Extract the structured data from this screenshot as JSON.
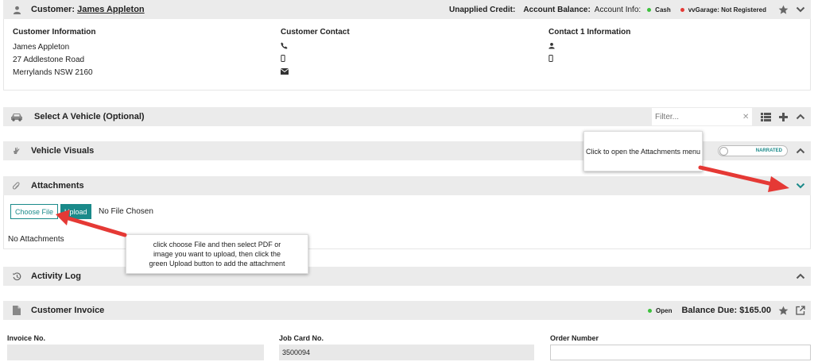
{
  "customer_header": {
    "label": "Customer:",
    "name": "James Appleton",
    "unapplied_credit": "Unapplied Credit:",
    "account_balance": "Account Balance:",
    "account_info": "Account Info:",
    "status_cash": "Cash",
    "status_vvgarage": "vvGarage: Not Registered"
  },
  "customer_body": {
    "info_title": "Customer Information",
    "info_lines": [
      "James Appleton",
      "27 Addlestone Road",
      "Merrylands NSW 2160"
    ],
    "contact_title": "Customer Contact",
    "contact1_title": "Contact 1 Information"
  },
  "vehicle_section": {
    "title": "Select A Vehicle (Optional)",
    "filter_placeholder": "Filter..."
  },
  "visuals_section": {
    "title": "Vehicle Visuals",
    "toggle_label": "NARRATED"
  },
  "attachments_section": {
    "title": "Attachments",
    "choose_label": "Choose File",
    "upload_label": "Upload",
    "file_status": "No File Chosen",
    "empty_text": "No Attachments"
  },
  "activity_section": {
    "title": "Activity Log"
  },
  "invoice_section": {
    "title": "Customer Invoice",
    "status": "Open",
    "balance_due": "Balance Due: $165.00",
    "invoice_no_label": "Invoice No.",
    "invoice_no_value": "",
    "job_card_label": "Job Card No.",
    "job_card_value": "3500094",
    "order_number_label": "Order Number",
    "order_number_value": ""
  },
  "tooltips": {
    "attachments_menu": "Click to open the Attachments menu",
    "upload_help": "click choose File and then select PDF or image you want to upload, then click the green Upload button to add the attachment"
  },
  "colors": {
    "teal": "#1a8a8a",
    "status_green": "#3cc13c",
    "status_red": "#e53935",
    "annotation_red": "#e53935"
  },
  "icons": {
    "customer": "user-icon",
    "vehicle": "car-icon",
    "visuals": "hand-icon",
    "attachments": "paperclip-icon",
    "activity": "history-icon",
    "invoice": "file-icon"
  }
}
